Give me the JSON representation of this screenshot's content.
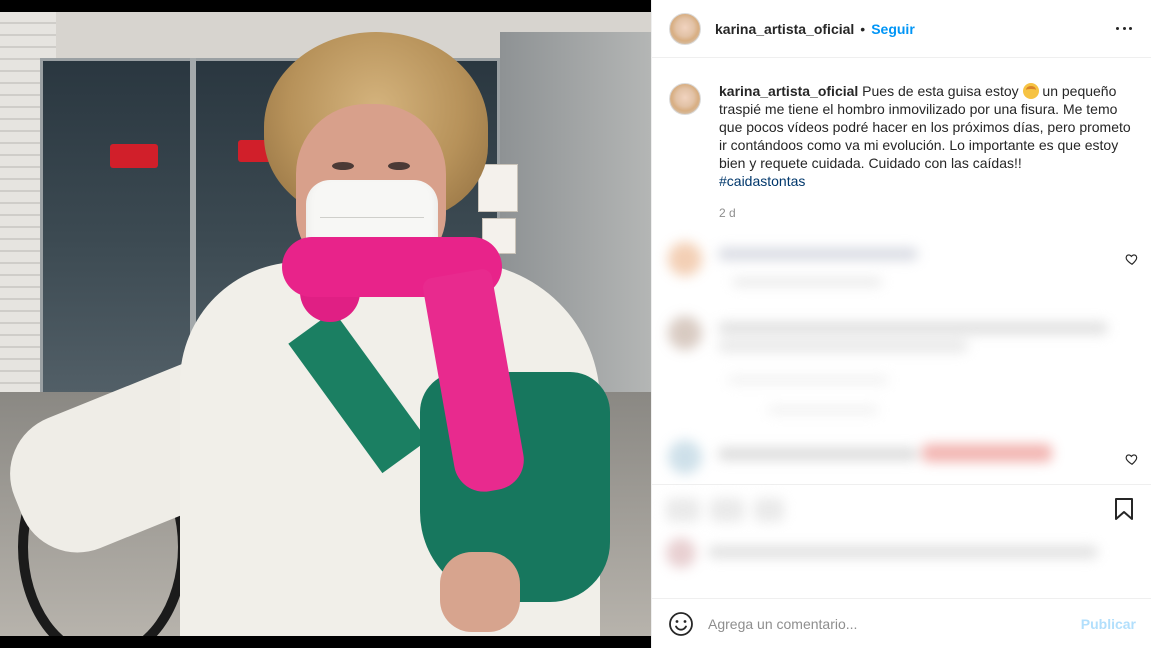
{
  "post": {
    "username": "karina_artista_oficial",
    "separator": "•",
    "follow_label": "Seguir",
    "caption_user": "karina_artista_oficial",
    "caption_part1": " Pues de esta guisa estoy ",
    "caption_part2": " un pequeño traspié me tiene el hombro inmovilizado por una fisura. Me temo que pocos vídeos podré hacer en los próximos días, pero prometo ir contándoos como va mi evolución. Lo importante es que estoy bien y requete cuidada. Cuidado con las caídas!!",
    "hashtag": "#caidastontas",
    "time_ago": "2 d",
    "emoji": "person-gesturing-no-emoji"
  },
  "add_comment": {
    "placeholder": "Agrega un comentario...",
    "publish_label": "Publicar"
  },
  "icons": {
    "more": "more-options-icon",
    "heart": "heart-icon",
    "bookmark": "bookmark-icon",
    "emoji_picker": "smile-icon"
  },
  "colors": {
    "link_blue": "#0095f6",
    "publish_disabled": "#b2dffc",
    "hashtag": "#00376b",
    "secondary_text": "#8e8e8e"
  }
}
